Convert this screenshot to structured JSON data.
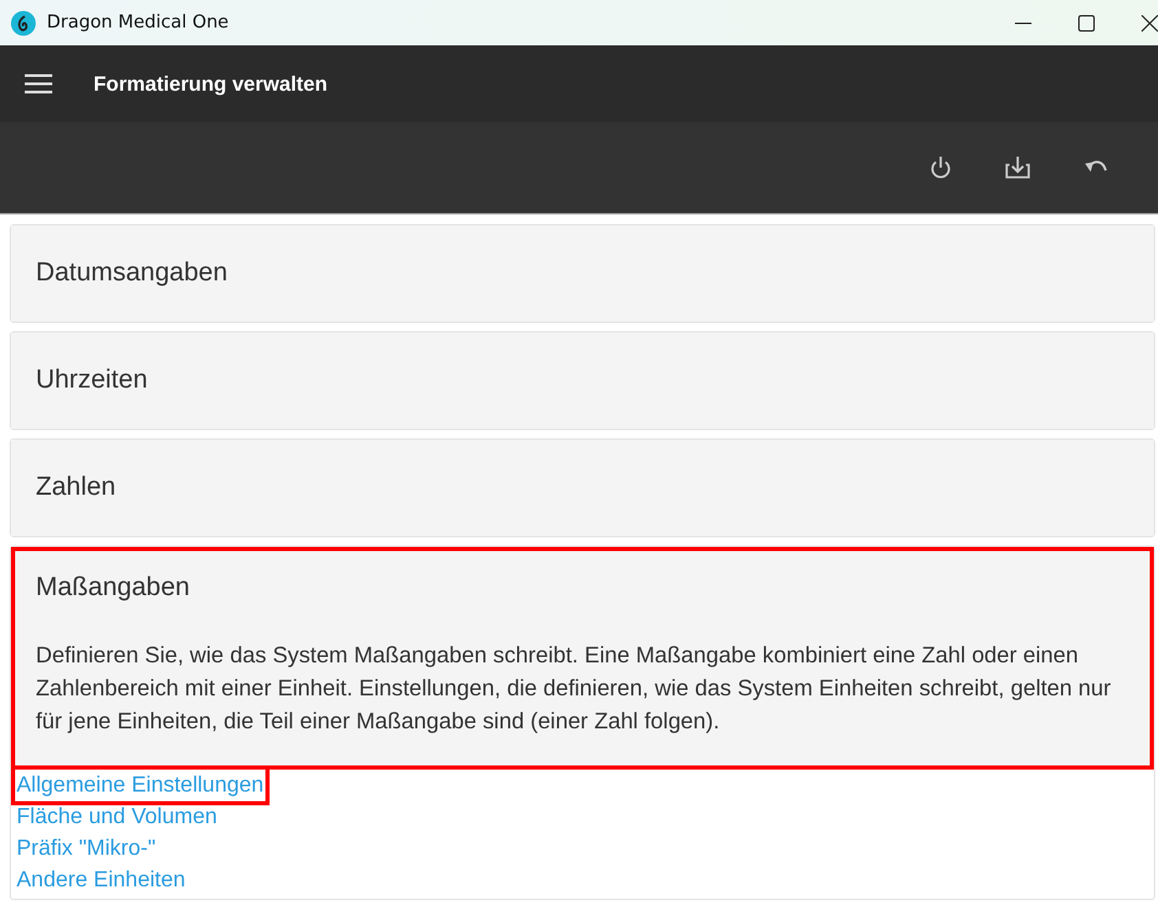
{
  "window": {
    "title": "Dragon Medical One"
  },
  "header": {
    "title": "Formatierung verwalten"
  },
  "sections": [
    {
      "title": "Datumsangaben",
      "expanded": false,
      "highlighted": false
    },
    {
      "title": "Uhrzeiten",
      "expanded": false,
      "highlighted": false
    },
    {
      "title": "Zahlen",
      "expanded": false,
      "highlighted": false
    },
    {
      "title": "Maßangaben",
      "expanded": true,
      "highlighted": true,
      "description": "Definieren Sie, wie das System Maßangaben schreibt. Eine Maßangabe kombiniert eine Zahl oder einen Zahlenbereich mit einer Einheit. Einstellungen, die definieren, wie das System Einheiten schreibt, gelten nur für jene Einheiten, die Teil einer Maßangabe sind (einer Zahl folgen).",
      "links": [
        {
          "label": "Allgemeine Einstellungen",
          "highlighted": true
        },
        {
          "label": "Fläche und Volumen",
          "highlighted": false
        },
        {
          "label": "Präfix \"Mikro-\"",
          "highlighted": false
        },
        {
          "label": "Andere Einheiten",
          "highlighted": false
        }
      ]
    }
  ]
}
